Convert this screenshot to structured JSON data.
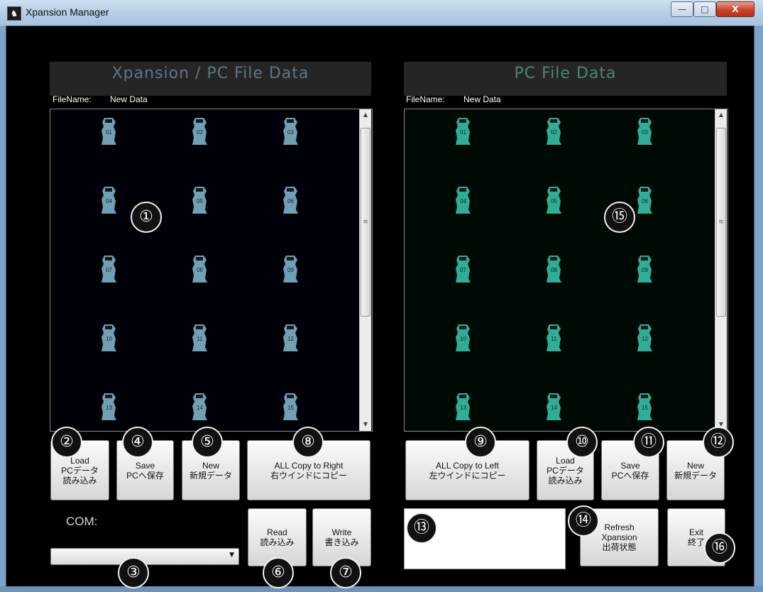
{
  "window": {
    "title": "Xpansion Manager",
    "minimize": "—",
    "maximize": "□",
    "close": "X",
    "icon": "app-icon"
  },
  "left_panel": {
    "header": "Xpansion / PC File Data",
    "filename_label": "FileName:",
    "filename_value": "New Data",
    "header_color": "#5d7688",
    "icon_color": "#6fa0b4",
    "grid_bg": "#000009",
    "slots": [
      "01",
      "02",
      "03",
      "04",
      "05",
      "06",
      "07",
      "08",
      "09",
      "10",
      "11",
      "12",
      "13",
      "14",
      "15"
    ]
  },
  "right_panel": {
    "header": "PC File Data",
    "filename_label": "FileName:",
    "filename_value": "New Data",
    "header_color": "#4b8478",
    "icon_color": "#2fae95",
    "grid_bg": "#000a04",
    "slots": [
      "01",
      "02",
      "03",
      "04",
      "05",
      "06",
      "07",
      "08",
      "09",
      "10",
      "11",
      "12",
      "13",
      "14",
      "15"
    ]
  },
  "left_buttons": {
    "load": [
      "Load",
      "PCデータ",
      "読み込み"
    ],
    "save": [
      "Save",
      "PCへ保存"
    ],
    "new": [
      "New",
      "新規データ"
    ],
    "copy_right": [
      "ALL Copy to Right",
      "右ウインドにコピー"
    ]
  },
  "right_buttons": {
    "copy_left": [
      "ALL Copy to Left",
      "左ウインドにコピー"
    ],
    "load": [
      "Load",
      "PCデータ",
      "読み込み"
    ],
    "save": [
      "Save",
      "PCへ保存"
    ],
    "new": [
      "New",
      "新規データ"
    ]
  },
  "com": {
    "label": "COM:",
    "selected": ""
  },
  "device_buttons": {
    "read": [
      "Read",
      "読み込み"
    ],
    "write": [
      "Write",
      "書き込み"
    ],
    "refresh": [
      "Refresh",
      "Xpansion",
      "出荷状態"
    ],
    "exit": [
      "Exit",
      "終了"
    ]
  },
  "markers": [
    "①",
    "②",
    "③",
    "④",
    "⑤",
    "⑥",
    "⑦",
    "⑧",
    "⑨",
    "⑩",
    "⑪",
    "⑫",
    "⑬",
    "⑭",
    "⑮",
    "⑯"
  ]
}
